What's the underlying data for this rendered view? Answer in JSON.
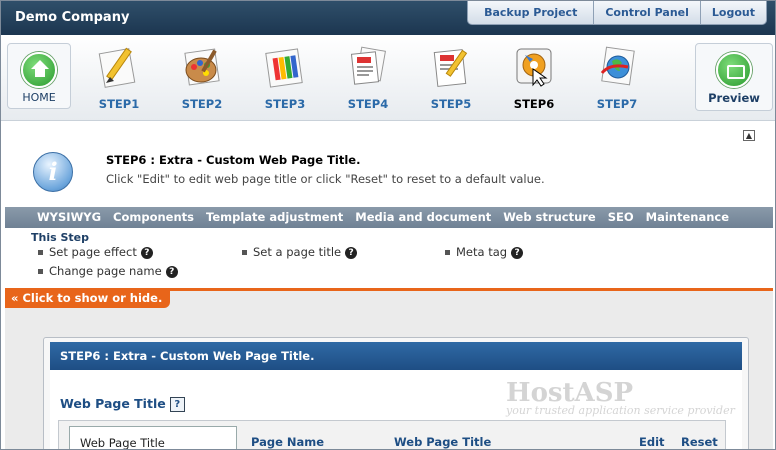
{
  "header": {
    "company": "Demo Company",
    "links": [
      "Backup Project",
      "Control Panel",
      "Logout"
    ]
  },
  "nav": {
    "home_label": "HOME",
    "preview_label": "Preview",
    "steps": [
      {
        "label": "STEP1",
        "icon": "pencil-paper-icon"
      },
      {
        "label": "STEP2",
        "icon": "paint-palette-icon"
      },
      {
        "label": "STEP3",
        "icon": "color-swatches-icon"
      },
      {
        "label": "STEP4",
        "icon": "documents-icon"
      },
      {
        "label": "STEP5",
        "icon": "document-edit-icon"
      },
      {
        "label": "STEP6",
        "icon": "puzzle-gear-icon",
        "active": true
      },
      {
        "label": "STEP7",
        "icon": "globe-arrow-icon"
      }
    ]
  },
  "info": {
    "title": "STEP6 : Extra - Custom Web Page Title.",
    "description": "Click \"Edit\" to edit web page title or click \"Reset\" to reset to a default value."
  },
  "menu": {
    "items": [
      "WYSIWYG",
      "Components",
      "Template adjustment",
      "Media and document",
      "Web structure",
      "SEO",
      "Maintenance"
    ]
  },
  "this_step": {
    "title": "This Step",
    "tasks": [
      "Set page effect",
      "Set a page title",
      "Meta tag",
      "Change page name"
    ]
  },
  "toggle_label": "Click to show or hide.",
  "panel": {
    "header": "STEP6 : Extra - Custom Web Page Title.",
    "section_title": "Web Page Title",
    "help_glyph": "?",
    "watermark": {
      "brand": "HostASP",
      "tagline": "your trusted application service provider"
    },
    "left_item": "Web Page Title",
    "columns": [
      "Page Name",
      "Web Page Title",
      "Edit",
      "Reset"
    ]
  },
  "colors": {
    "accent": "#e8651a",
    "header_blue": "#1e4e84",
    "link_blue": "#2b6aa8"
  }
}
